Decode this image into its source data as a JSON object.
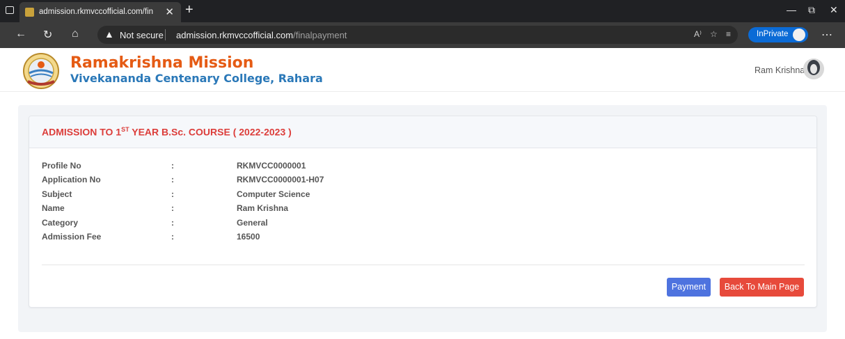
{
  "browser": {
    "tab_title": "admission.rkmvccofficial.com/fin",
    "security_label": "Not secure",
    "url_host": "admission.rkmvccofficial.com",
    "url_path": "/finalpayment",
    "inprivate_label": "InPrivate"
  },
  "site": {
    "org_name": "Ramakrishna Mission",
    "org_subtitle": "Vivekananda Centenary College, Rahara",
    "user_name": "Ram Krishna"
  },
  "card": {
    "title_prefix": "ADMISSION TO 1",
    "title_sup": "ST",
    "title_suffix": " YEAR B.Sc. COURSE ( 2022-2023 )",
    "separator": ":",
    "fields": [
      {
        "label": "Profile No",
        "value": "RKMVCC0000001"
      },
      {
        "label": "Application No",
        "value": "RKMVCC0000001-H07"
      },
      {
        "label": "Subject",
        "value": "Computer Science"
      },
      {
        "label": "Name",
        "value": "Ram Krishna"
      },
      {
        "label": "Category",
        "value": "General"
      },
      {
        "label": "Admission Fee",
        "value": "16500"
      }
    ],
    "payment_label": "Payment",
    "back_label": "Back To Main Page"
  },
  "colors": {
    "org_name": "#e55b14",
    "org_subtitle": "#2a78b8",
    "title": "#dc3d3a",
    "payment_button": "#4e73df",
    "back_button": "#e74a3b"
  }
}
